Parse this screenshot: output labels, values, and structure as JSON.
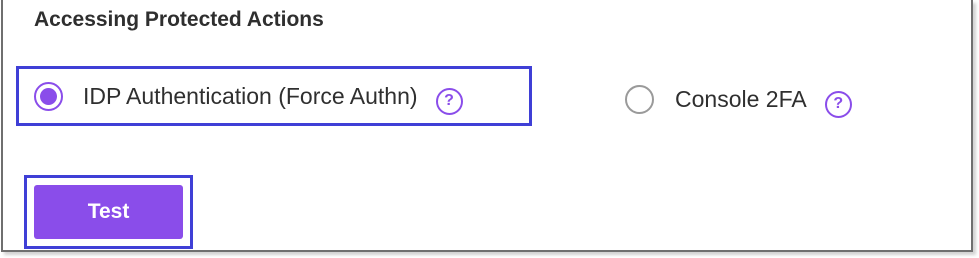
{
  "section": {
    "title": "Accessing Protected Actions"
  },
  "options": [
    {
      "label": "IDP Authentication (Force Authn)",
      "selected": true,
      "help_icon": "?"
    },
    {
      "label": "Console 2FA",
      "selected": false,
      "help_icon": "?"
    }
  ],
  "actions": {
    "test_label": "Test"
  },
  "colors": {
    "accent": "#8a4dea",
    "highlight_border": "#3f3fd6",
    "text": "#2f2f2f",
    "radio_unselected": "#9a9a9a"
  },
  "icons": {
    "help": "question-circle-icon",
    "radio_selected": "radio-selected-icon",
    "radio_unselected": "radio-unselected-icon"
  }
}
